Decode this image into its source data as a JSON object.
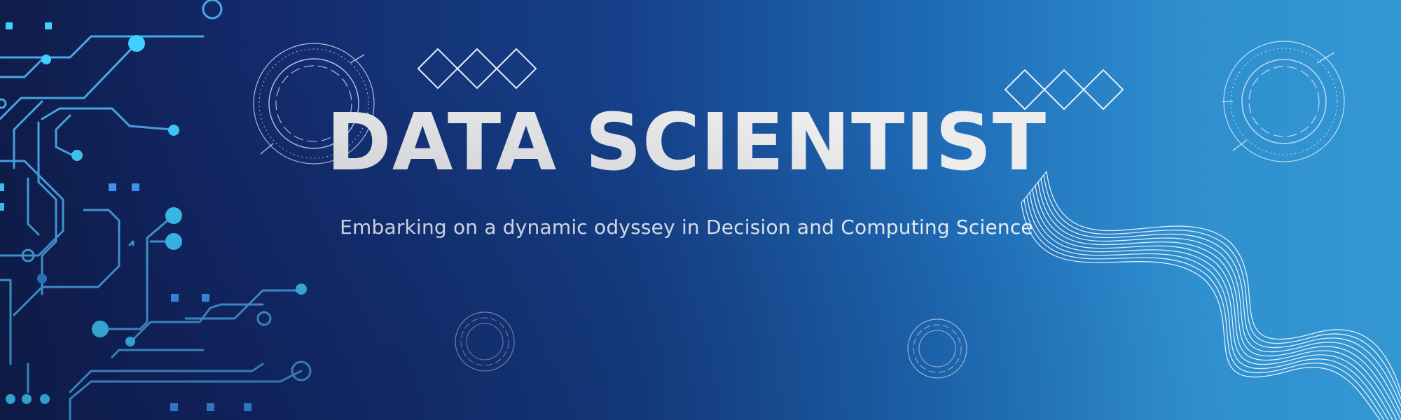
{
  "banner": {
    "title": "DATA SCIENTIST",
    "subtitle": "Embarking on a dynamic odyssey in Decision and Computing Science"
  },
  "colors": {
    "bg_dark": "#0f1d4a",
    "bg_light": "#3497d3",
    "circuit": "#4fb4f0",
    "circuit_node": "#3fd0ff",
    "title_text": "#ececec",
    "line_art": "#ffffff"
  },
  "icons": [
    "circuit-board-icon",
    "hud-ring-icon",
    "diamond-row-icon",
    "wave-ribbon-icon"
  ]
}
